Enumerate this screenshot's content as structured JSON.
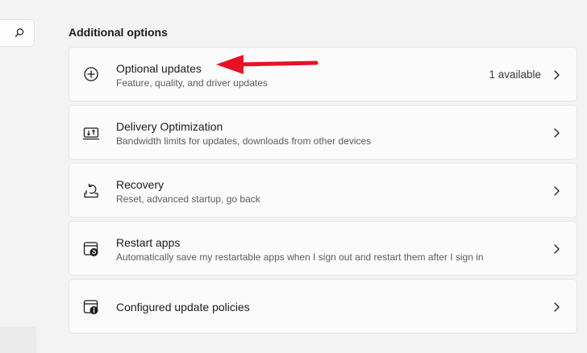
{
  "search": {
    "icon": "search-icon"
  },
  "section": {
    "title": "Additional options"
  },
  "options": [
    {
      "icon": "plus-circle-icon",
      "title": "Optional updates",
      "description": "Feature, quality, and driver updates",
      "status": "1 available"
    },
    {
      "icon": "delivery-optimization-icon",
      "title": "Delivery Optimization",
      "description": "Bandwidth limits for updates, downloads from other devices"
    },
    {
      "icon": "recovery-icon",
      "title": "Recovery",
      "description": "Reset, advanced startup, go back"
    },
    {
      "icon": "restart-apps-icon",
      "title": "Restart apps",
      "description": "Automatically save my restartable apps when I sign out and restart them after I sign in"
    },
    {
      "icon": "update-policy-icon",
      "title": "Configured update policies"
    }
  ],
  "colors": {
    "background": "#f3f3f3",
    "card": "#fbfbfb",
    "annotation_arrow": "#e81123"
  }
}
